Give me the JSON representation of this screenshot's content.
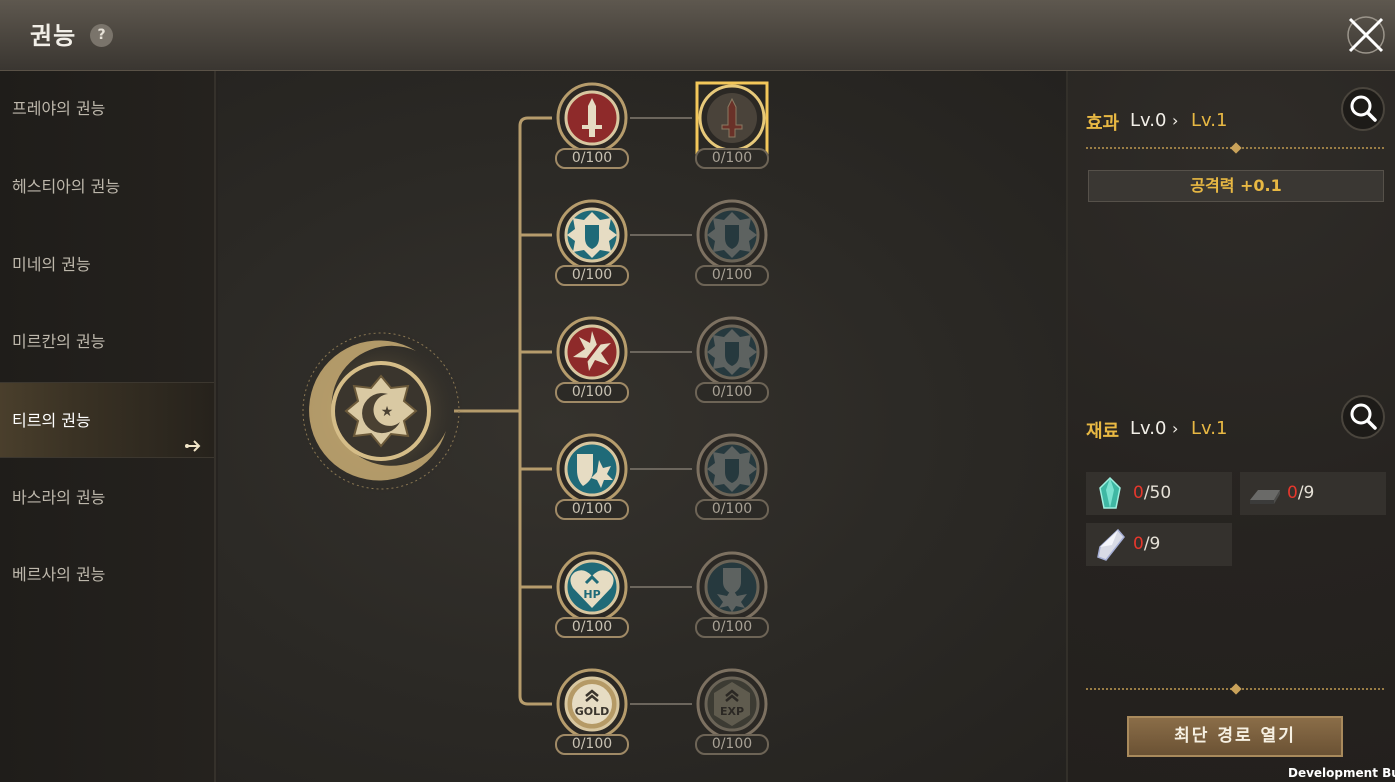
{
  "header": {
    "title": "권능",
    "help_label": "?"
  },
  "sidebar": {
    "items": [
      {
        "label": "프레야의 권능"
      },
      {
        "label": "헤스티아의 권능"
      },
      {
        "label": "미네의 권능"
      },
      {
        "label": "미르칸의 권능"
      },
      {
        "label": "티르의 권능",
        "active": true
      },
      {
        "label": "바스라의 권능"
      },
      {
        "label": "베르사의 권능"
      }
    ]
  },
  "tree": {
    "root_icon": "crescent-moon-star-emblem-icon",
    "rows": [
      {
        "left": {
          "icon": "sword-icon",
          "count": "0/100",
          "color": "#8e2a2a"
        },
        "right": {
          "icon": "sword-icon",
          "count": "0/100",
          "selected": true
        }
      },
      {
        "left": {
          "icon": "shield-icon",
          "count": "0/100",
          "color": "#1f6a78"
        },
        "right": {
          "icon": "shield-icon",
          "count": "0/100"
        }
      },
      {
        "left": {
          "icon": "burst-sword-icon",
          "count": "0/100",
          "color": "#8e2a2a"
        },
        "right": {
          "icon": "shield-icon",
          "count": "0/100"
        }
      },
      {
        "left": {
          "icon": "shield-burst-icon",
          "count": "0/100",
          "color": "#1f6a78"
        },
        "right": {
          "icon": "shield-icon",
          "count": "0/100"
        }
      },
      {
        "left": {
          "icon": "hp-heart-icon",
          "label": "HP",
          "count": "0/100",
          "color": "#1f6a78"
        },
        "right": {
          "icon": "shield-burst-icon",
          "count": "0/100"
        }
      },
      {
        "left": {
          "icon": "gold-emblem-icon",
          "label": "GOLD",
          "count": "0/100",
          "color": "#b59a66"
        },
        "right": {
          "icon": "exp-emblem-icon",
          "label": "EXP",
          "count": "0/100"
        }
      }
    ]
  },
  "effect": {
    "title": "효과",
    "from": "Lv.0",
    "to": "Lv.1",
    "rows": [
      "공격력 +0.1"
    ]
  },
  "materials": {
    "title": "재료",
    "from": "Lv.0",
    "to": "Lv.1",
    "items": [
      {
        "icon": "green-crystal-icon",
        "have": "0",
        "need": "/50"
      },
      {
        "icon": "metal-ingot-icon",
        "have": "0",
        "need": "/9"
      },
      {
        "icon": "white-crystal-icon",
        "have": "0",
        "need": "/9"
      }
    ]
  },
  "route_button": "최단 경로 열기",
  "dev_label": "Development Build",
  "colors": {
    "accent": "#e8b843",
    "need_red": "#e5372c",
    "frame_gold": "#b69c6c"
  }
}
